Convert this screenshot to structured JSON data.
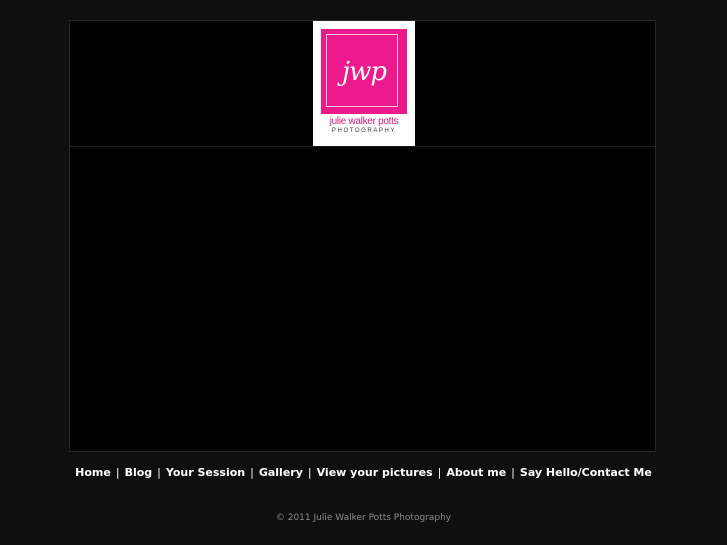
{
  "logo": {
    "monogram": "jwp",
    "name": "julie walker potts",
    "subtitle": "PHOTOGRAPHY",
    "colors": {
      "pink": "#ec1a8d",
      "background": "#ffffff"
    }
  },
  "nav": {
    "items": [
      {
        "label": "Home"
      },
      {
        "label": "Blog"
      },
      {
        "label": "Your Session"
      },
      {
        "label": "Gallery"
      },
      {
        "label": "View your pictures"
      },
      {
        "label": "About me"
      },
      {
        "label": "Say Hello/Contact Me"
      }
    ],
    "separator": "|"
  },
  "footer": {
    "copyright": "© 2011 Julie Walker Potts Photography"
  },
  "colors": {
    "page_background": "#0f0f0f",
    "frame_background": "#000000",
    "nav_text": "#ffffff",
    "footer_text": "#8a8a8a"
  }
}
